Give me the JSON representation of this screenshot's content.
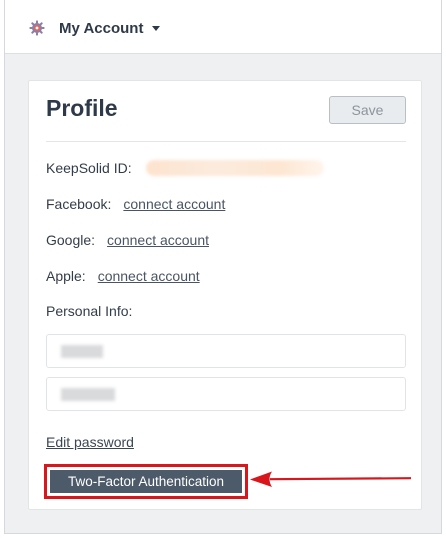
{
  "topbar": {
    "account_label": "My Account",
    "icons": {
      "settings": "gear-icon",
      "dropdown": "caret-down-icon"
    }
  },
  "profile": {
    "title": "Profile",
    "save_label": "Save",
    "keepsolid_label": "KeepSolid ID:",
    "facebook_label": "Facebook:",
    "facebook_link": "connect account",
    "google_label": "Google:",
    "google_link": "connect account",
    "apple_label": "Apple:",
    "apple_link": "connect account",
    "personal_info_label": "Personal Info:",
    "edit_password_label": "Edit password",
    "two_factor_label": "Two-Factor Authentication"
  },
  "colors": {
    "highlight": "#d9161c",
    "primary_button": "#4c5a6a",
    "background": "#eef0f2"
  }
}
